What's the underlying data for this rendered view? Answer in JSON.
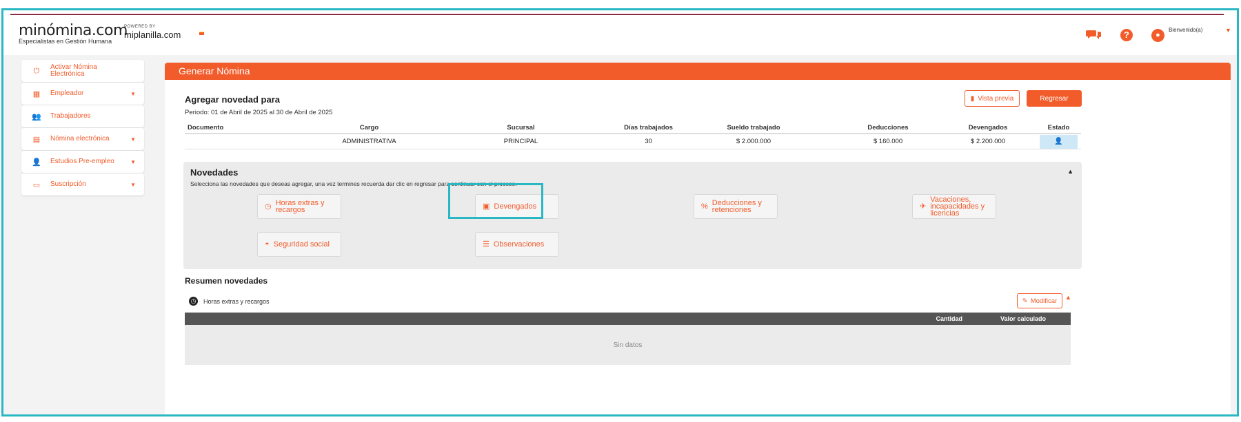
{
  "header": {
    "logo": "minómina.com",
    "tagline": "Especialistas en Gestión Humana",
    "powered_by": "POWERED BY",
    "partner": "miplanilla.com",
    "welcome": "Bienvenido(a)"
  },
  "sidebar": {
    "items": [
      {
        "label": "Activar Nómina Electrónica",
        "icon": "power-icon",
        "has_chevron": false
      },
      {
        "label": "Empleador",
        "icon": "building-icon",
        "has_chevron": true
      },
      {
        "label": "Trabajadores",
        "icon": "users-icon",
        "has_chevron": false
      },
      {
        "label": "Nómina electrónica",
        "icon": "document-icon",
        "has_chevron": true
      },
      {
        "label": "Estudios Pre-empleo",
        "icon": "user-plus-icon",
        "has_chevron": true
      },
      {
        "label": "Suscripción",
        "icon": "id-card-icon",
        "has_chevron": true
      }
    ]
  },
  "panel": {
    "title": "Generar Nómina",
    "agregar": "Agregar novedad para",
    "periodo": "Periodo: 01 de Abril de 2025 al 30 de Abril de 2025",
    "btn_preview": "Vista previa",
    "btn_regresar": "Regresar"
  },
  "table": {
    "columns": [
      "Documento",
      "Cargo",
      "Sucursal",
      "Días trabajados",
      "Sueldo trabajado",
      "Deducciones",
      "Devengados",
      "Estado"
    ],
    "rows": [
      {
        "documento": "",
        "cargo": "ADMINISTRATIVA",
        "sucursal": "PRINCIPAL",
        "dias": "30",
        "sueldo": "$ 2.000.000",
        "deducciones": "$ 160.000",
        "devengados": "$ 2.200.000"
      }
    ]
  },
  "novedades": {
    "title": "Novedades",
    "description": "Selecciona las novedades que deseas agregar, una vez termines recuerda dar clic en regresar para continuar con el proceso.",
    "buttons": [
      {
        "label": "Horas extras y recargos",
        "icon": "clock-icon"
      },
      {
        "label": "Devengados",
        "icon": "money-icon"
      },
      {
        "label": "Deducciones y retenciones",
        "icon": "percent-icon"
      },
      {
        "label": "Vacaciones, incapacidades y licencias",
        "icon": "plane-icon"
      },
      {
        "label": "Seguridad social",
        "icon": "helmet-icon"
      },
      {
        "label": "Observaciones",
        "icon": "lines-icon"
      }
    ]
  },
  "resumen": {
    "title": "Resumen novedades",
    "section": "Horas extras y recargos",
    "btn_modificar": "Modificar",
    "col_cantidad": "Cantidad",
    "col_valor": "Valor calculado",
    "empty": "Sin datos"
  },
  "colors": {
    "accent": "#f25b2a",
    "highlight": "#29b8c3",
    "brand_line": "#8a2a48"
  }
}
